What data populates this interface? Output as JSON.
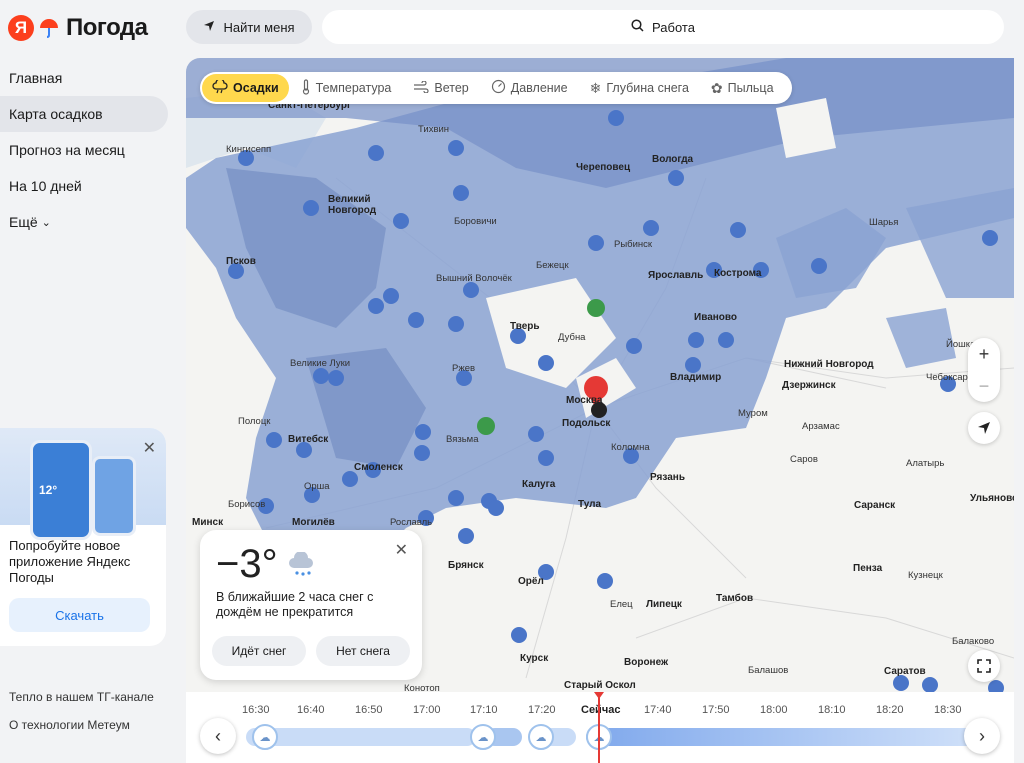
{
  "app": {
    "logo_letter": "Я",
    "title": "Погода"
  },
  "nav": {
    "items": [
      {
        "label": "Главная"
      },
      {
        "label": "Карта осадков"
      },
      {
        "label": "Прогноз на месяц"
      },
      {
        "label": "На 10 дней"
      },
      {
        "label": "Ещё"
      }
    ],
    "active_index": 1
  },
  "promo": {
    "phone_temp": "12°",
    "text": "Попробуйте новое приложение Яндекс Погоды",
    "button": "Скачать"
  },
  "footer": {
    "tg_link": "Тепло в нашем ТГ-канале",
    "tech_link": "О технологии Метеум"
  },
  "topbar": {
    "locate_button": "Найти меня",
    "search_value": "Работа"
  },
  "layers": [
    {
      "label": "Осадки",
      "icon": "cloud-rain-icon"
    },
    {
      "label": "Температура",
      "icon": "thermometer-icon"
    },
    {
      "label": "Ветер",
      "icon": "wind-icon"
    },
    {
      "label": "Давление",
      "icon": "gauge-icon"
    },
    {
      "label": "Глубина снега",
      "icon": "snowflake-icon"
    },
    {
      "label": "Пыльца",
      "icon": "pollen-icon"
    }
  ],
  "cities": [
    {
      "name": "Санкт-Петербург",
      "bold": true
    },
    {
      "name": "Тихвин"
    },
    {
      "name": "Кингисепп"
    },
    {
      "name": "Череповец",
      "bold": true
    },
    {
      "name": "Вологда",
      "bold": true
    },
    {
      "name": "Великий Новгород",
      "bold": true
    },
    {
      "name": "Боровичи"
    },
    {
      "name": "Рыбинск"
    },
    {
      "name": "Шарья"
    },
    {
      "name": "Псков",
      "bold": true
    },
    {
      "name": "Вышний Волочёк"
    },
    {
      "name": "Бежецк"
    },
    {
      "name": "Ярославль",
      "bold": true
    },
    {
      "name": "Кострома",
      "bold": true
    },
    {
      "name": "Тверь",
      "bold": true
    },
    {
      "name": "Дубна"
    },
    {
      "name": "Иваново",
      "bold": true
    },
    {
      "name": "Великие Луки"
    },
    {
      "name": "Ржев"
    },
    {
      "name": "Нижний Новгород",
      "bold": true
    },
    {
      "name": "Йошкар"
    },
    {
      "name": "Владимир",
      "bold": true
    },
    {
      "name": "Москва",
      "bold": true
    },
    {
      "name": "Дзержинск",
      "bold": true
    },
    {
      "name": "Чебоксары"
    },
    {
      "name": "Полоцк"
    },
    {
      "name": "Подольск",
      "bold": true
    },
    {
      "name": "Муром"
    },
    {
      "name": "Витебск",
      "bold": true
    },
    {
      "name": "Вязьма"
    },
    {
      "name": "Арзамас"
    },
    {
      "name": "Коломна"
    },
    {
      "name": "Смоленск",
      "bold": true
    },
    {
      "name": "Саров"
    },
    {
      "name": "Алатырь"
    },
    {
      "name": "Рязань",
      "bold": true
    },
    {
      "name": "Калуга",
      "bold": true
    },
    {
      "name": "Орша"
    },
    {
      "name": "Борисов"
    },
    {
      "name": "Тула",
      "bold": true
    },
    {
      "name": "Минск",
      "bold": true
    },
    {
      "name": "Могилёв",
      "bold": true
    },
    {
      "name": "Рославль"
    },
    {
      "name": "Саранск",
      "bold": true
    },
    {
      "name": "Ульяновск",
      "bold": true
    },
    {
      "name": "Брянск",
      "bold": true
    },
    {
      "name": "Пенза",
      "bold": true
    },
    {
      "name": "Орёл",
      "bold": true
    },
    {
      "name": "Кузнецк"
    },
    {
      "name": "Тамбов",
      "bold": true
    },
    {
      "name": "Елец"
    },
    {
      "name": "Липецк",
      "bold": true
    },
    {
      "name": "Балаково"
    },
    {
      "name": "Курск",
      "bold": true
    },
    {
      "name": "Воронеж",
      "bold": true
    },
    {
      "name": "Балашов"
    },
    {
      "name": "Саратов",
      "bold": true
    },
    {
      "name": "Старый Оскол",
      "bold": true
    },
    {
      "name": "Конотоп"
    }
  ],
  "weather_card": {
    "temperature": "−3°",
    "description": "В ближайшие 2 часа снег с дождём не прекратится",
    "chip_snow": "Идёт снег",
    "chip_no_snow": "Нет снега"
  },
  "timeline": {
    "labels": [
      "16:30",
      "16:40",
      "16:50",
      "17:00",
      "17:10",
      "17:20",
      "Сейчас",
      "17:40",
      "17:50",
      "18:00",
      "18:10",
      "18:20",
      "18:30"
    ],
    "now_index": 6
  },
  "colors": {
    "accent_yellow": "#ffd84d",
    "precip": "#7a94c8",
    "now_line": "#e53935"
  }
}
